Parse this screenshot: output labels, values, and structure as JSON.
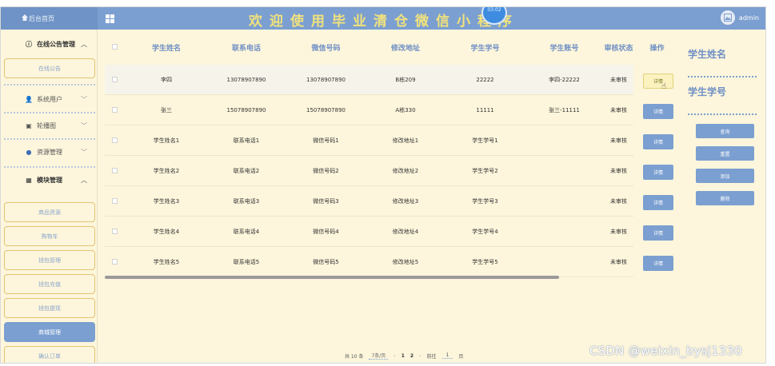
{
  "header": {
    "home_label": "后台首页",
    "app_title": "欢迎使用毕业清仓微信小程序",
    "version_badge": "03:02",
    "user_name": "admin"
  },
  "sidebar": {
    "groups": [
      {
        "label": "在线公告管理",
        "icon": "info-icon",
        "items": [
          "在线公告"
        ]
      },
      {
        "label": "系统用户",
        "icon": "user-icon",
        "items": []
      },
      {
        "label": "轮播图",
        "icon": "image-icon",
        "items": []
      },
      {
        "label": "资源管理",
        "icon": "location-icon",
        "items": []
      },
      {
        "label": "模块管理",
        "icon": "grid-icon",
        "items": [
          "商品资源",
          "购物车",
          "钱包管理",
          "钱包充值",
          "钱包提现",
          "商城管理",
          "确认订单"
        ]
      }
    ],
    "active_item": "商城管理"
  },
  "table": {
    "columns": [
      "学生姓名",
      "联系电话",
      "微信号码",
      "修改地址",
      "学生学号",
      "学生账号",
      "审核状态"
    ],
    "rows": [
      [
        "李四",
        "13078907890",
        "13078907890",
        "B栋209",
        "22222",
        "李四-22222",
        "未审核"
      ],
      [
        "张三",
        "15078907890",
        "15078907890",
        "A栋330",
        "11111",
        "张三-11111",
        "未审核"
      ],
      [
        "学生姓名1",
        "联系电话1",
        "微信号码1",
        "修改地址1",
        "学生学号1",
        "",
        "未审核"
      ],
      [
        "学生姓名2",
        "联系电话2",
        "微信号码2",
        "修改地址2",
        "学生学号2",
        "",
        "未审核"
      ],
      [
        "学生姓名3",
        "联系电话3",
        "微信号码3",
        "修改地址3",
        "学生学号3",
        "",
        "未审核"
      ],
      [
        "学生姓名4",
        "联系电话4",
        "微信号码4",
        "修改地址4",
        "学生学号4",
        "",
        "未审核"
      ],
      [
        "学生姓名5",
        "联系电话5",
        "微信号码5",
        "修改地址5",
        "学生学号5",
        "",
        "未审核"
      ]
    ],
    "operation_header": "操作",
    "detail_label": "详情"
  },
  "search_panel": {
    "field1_label": "学生姓名",
    "field2_label": "学生学号",
    "buttons": [
      "查询",
      "重置",
      "添加",
      "删除"
    ]
  },
  "pagination": {
    "total": "共 10 条",
    "page_size": "7条/页",
    "pages": [
      "1",
      "2"
    ],
    "goto_label": "前往",
    "goto_value": "1",
    "page_unit": "页"
  },
  "watermark": "CSDN @weixin_bysj1330",
  "colors": {
    "accent": "#7b9fd0",
    "background": "#fdf6dc",
    "title": "#f2e27c"
  }
}
